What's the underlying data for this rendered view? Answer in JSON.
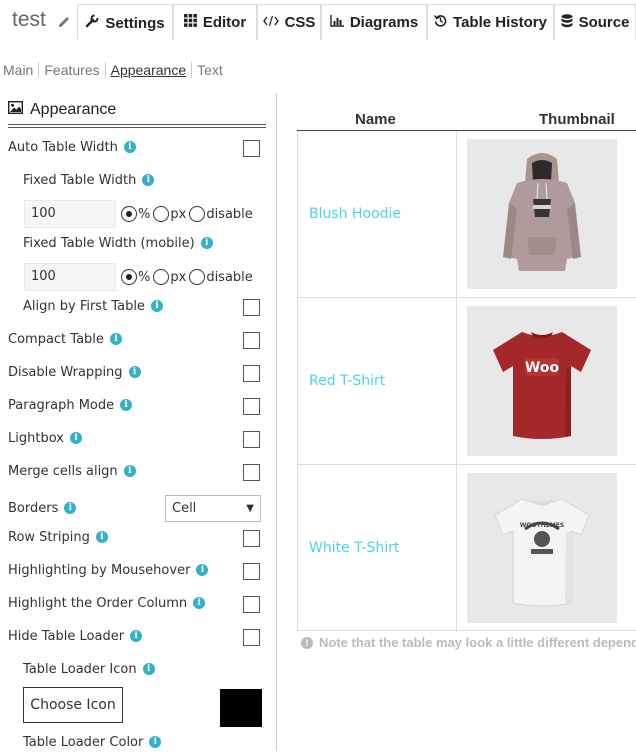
{
  "header": {
    "table_title": "test",
    "tabs": [
      {
        "label": "Settings",
        "icon": "wrench-icon",
        "active": true
      },
      {
        "label": "Editor",
        "icon": "grid-icon"
      },
      {
        "label": "CSS",
        "icon": "code-icon"
      },
      {
        "label": "Diagrams",
        "icon": "bar-chart-icon"
      },
      {
        "label": "Table History",
        "icon": "history-icon"
      },
      {
        "label": "Source",
        "icon": "database-icon"
      }
    ]
  },
  "subtabs": [
    "Main",
    "Features",
    "Appearance",
    "Text"
  ],
  "subtab_active": "Appearance",
  "panel": {
    "title": "Appearance",
    "auto_table_width": "Auto Table Width",
    "fixed_table_width": {
      "label": "Fixed Table Width",
      "value": "100",
      "unit_selected": "%"
    },
    "fixed_table_width_mobile": {
      "label": "Fixed Table Width (mobile)",
      "value": "100",
      "unit_selected": "%"
    },
    "units": [
      "%",
      "px",
      "disable"
    ],
    "align_first_table": "Align by First Table",
    "compact_table": "Compact Table",
    "disable_wrapping": "Disable Wrapping",
    "paragraph_mode": "Paragraph Mode",
    "lightbox": "Lightbox",
    "merge_cells_align": "Merge cells align",
    "borders": {
      "label": "Borders",
      "selected": "Cell"
    },
    "row_striping": "Row Striping",
    "highlight_mouseover": "Highlighting by Mousehover",
    "highlight_order_column": "Highlight the Order Column",
    "hide_table_loader": "Hide Table Loader",
    "table_loader_icon": {
      "label": "Table Loader Icon",
      "button": "Choose Icon",
      "swatch_color": "#000000"
    },
    "table_loader_color": "Table Loader Color"
  },
  "preview": {
    "columns": [
      "Name",
      "Thumbnail"
    ],
    "rows": [
      {
        "name": "Blush Hoodie",
        "thumbnail": "hoodie-image"
      },
      {
        "name": "Red T-Shirt",
        "thumbnail": "red-tshirt-image"
      },
      {
        "name": "White T-Shirt",
        "thumbnail": "white-tshirt-image"
      }
    ],
    "note": "Note that the table may look a little different dependi"
  },
  "colors": {
    "link": "#4ad4e6",
    "info": "#34b0c8",
    "hoodie": "#b09b9b",
    "red_shirt": "#a4282a",
    "white_shirt": "#f2f2f2"
  }
}
